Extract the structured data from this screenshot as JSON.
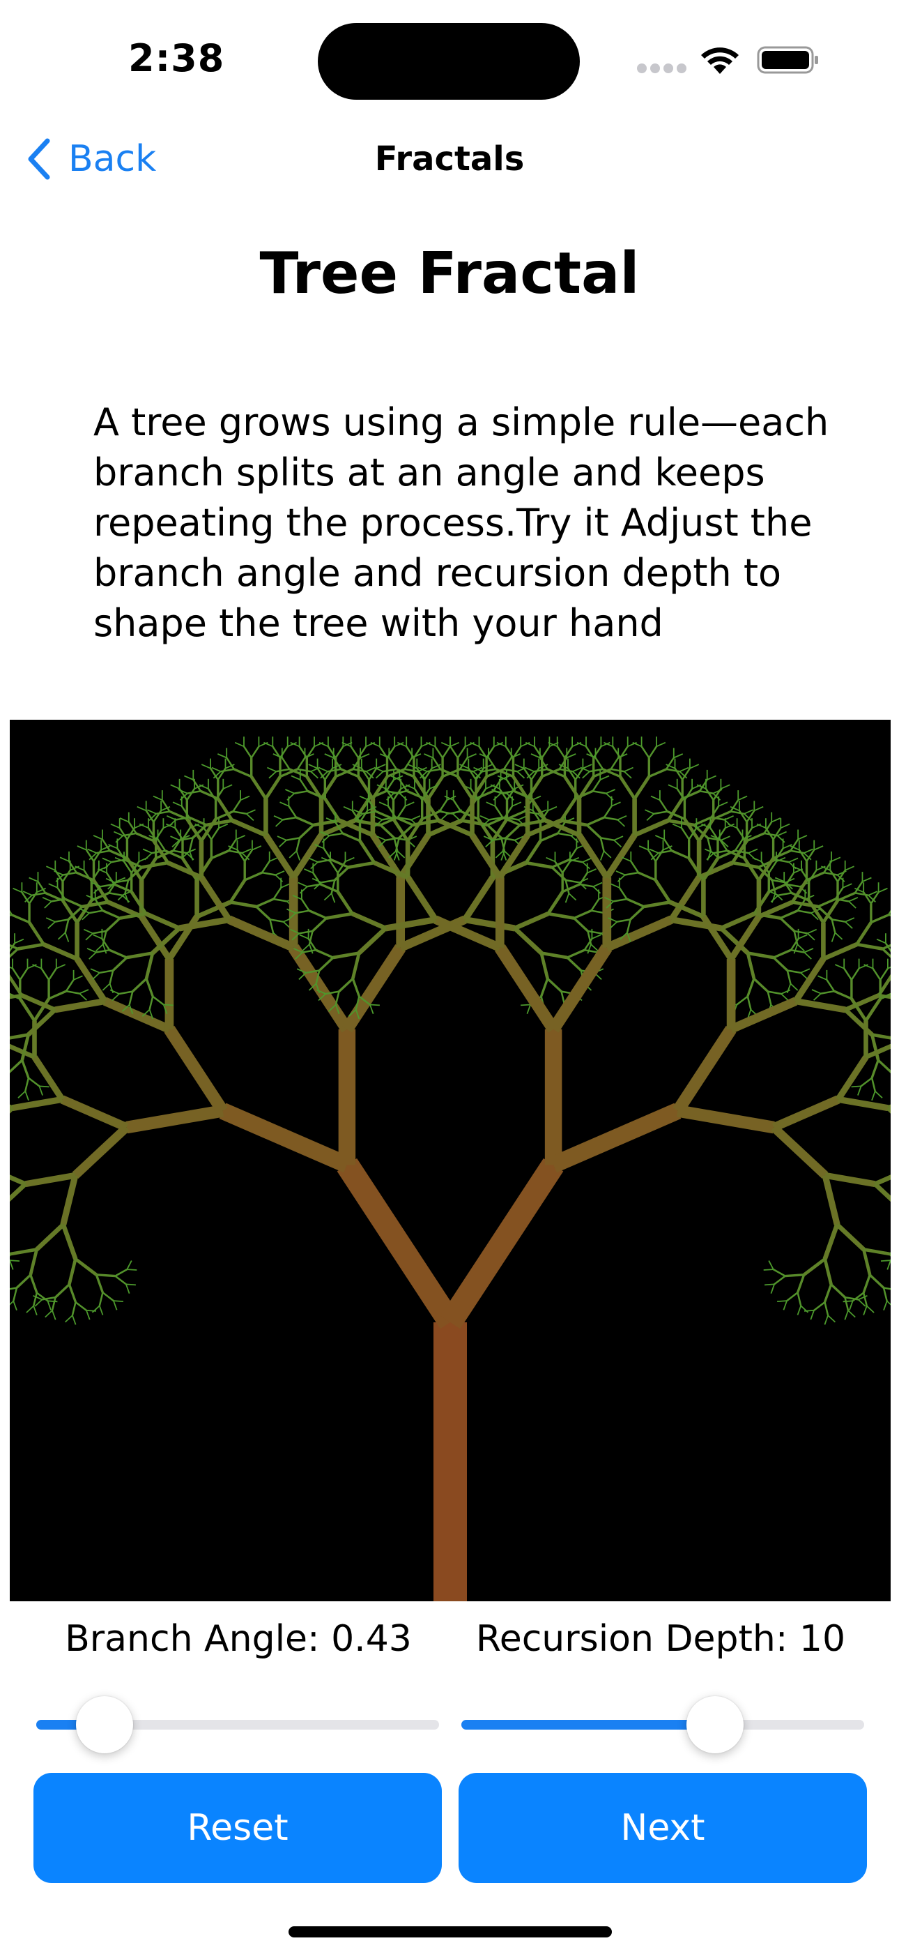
{
  "status_bar": {
    "time": "2:38"
  },
  "nav": {
    "back_label": "Back",
    "title": "Fractals"
  },
  "page": {
    "title": "Tree Fractal",
    "description": "A tree grows using a simple rule—each branch splits at an angle and keeps repeating the process.Try it Adjust the branch angle and recursion depth to shape the tree with your hand"
  },
  "controls": {
    "angle_label": "Branch Angle: 0.43",
    "depth_label": "Recursion Depth: 10",
    "angle_fraction": 0.17,
    "depth_fraction": 0.63,
    "reset_label": "Reset",
    "next_label": "Next"
  },
  "fractal": {
    "angle": 0.43,
    "depth": 10,
    "trunk_color": "#8a4a20",
    "leaf_color": "#4c9a2c",
    "background": "#000000"
  },
  "colors": {
    "accent": "#0a84ff",
    "link": "#1a80f2"
  }
}
